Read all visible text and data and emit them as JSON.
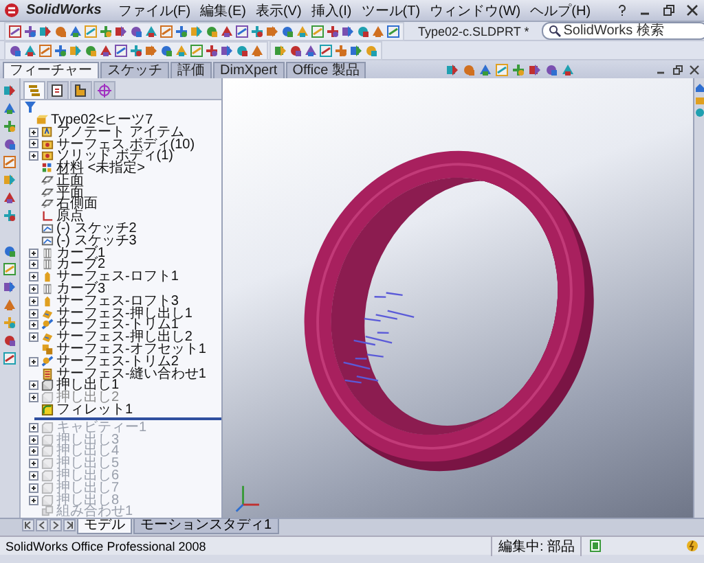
{
  "app": {
    "logo": "SolidWorks",
    "document_title": "Type02-c.SLDPRT *"
  },
  "menu": [
    "ファイル(F)",
    "編集(E)",
    "表示(V)",
    "挿入(I)",
    "ツール(T)",
    "ウィンドウ(W)",
    "ヘルプ(H)"
  ],
  "search": {
    "placeholder": "SolidWorks 検索"
  },
  "command_tabs": [
    {
      "label": "フィーチャー",
      "selected": true
    },
    {
      "label": "スケッチ",
      "selected": false
    },
    {
      "label": "評価",
      "selected": false
    },
    {
      "label": "DimXpert",
      "selected": false
    },
    {
      "label": "Office 製品",
      "selected": false
    }
  ],
  "feature_tree": {
    "tabs": [
      {
        "kind": "feature",
        "selected": true
      },
      {
        "kind": "property",
        "selected": false
      },
      {
        "kind": "configuration",
        "selected": false
      },
      {
        "kind": "dimxpert",
        "selected": false
      }
    ],
    "items": [
      {
        "label": "Type02<ヒーツ7",
        "kind": "part",
        "expandable": false,
        "suppressed": false,
        "rolled_back": false
      },
      {
        "label": "アノテート アイテム",
        "kind": "annotation",
        "expandable": true,
        "suppressed": false,
        "rolled_back": false
      },
      {
        "label": "サーフェス ボディ(10)",
        "kind": "folder",
        "expandable": true,
        "suppressed": false,
        "rolled_back": false
      },
      {
        "label": "ソリッド ボディ(1)",
        "kind": "folder",
        "expandable": true,
        "suppressed": false,
        "rolled_back": false
      },
      {
        "label": "材料 <未指定>",
        "kind": "material",
        "expandable": false,
        "suppressed": false,
        "rolled_back": false
      },
      {
        "label": "正面",
        "kind": "plane",
        "expandable": false,
        "suppressed": false,
        "rolled_back": false
      },
      {
        "label": "平面",
        "kind": "plane",
        "expandable": false,
        "suppressed": false,
        "rolled_back": false
      },
      {
        "label": "右側面",
        "kind": "plane",
        "expandable": false,
        "suppressed": false,
        "rolled_back": false
      },
      {
        "label": "原点",
        "kind": "origin",
        "expandable": false,
        "suppressed": false,
        "rolled_back": false
      },
      {
        "label": "(-) スケッチ2",
        "kind": "sketch",
        "expandable": false,
        "suppressed": false,
        "rolled_back": false
      },
      {
        "label": "(-) スケッチ3",
        "kind": "sketch",
        "expandable": false,
        "suppressed": false,
        "rolled_back": false
      },
      {
        "label": "カーブ1",
        "kind": "curve",
        "expandable": true,
        "suppressed": false,
        "rolled_back": false
      },
      {
        "label": "カーブ2",
        "kind": "curve",
        "expandable": true,
        "suppressed": false,
        "rolled_back": false
      },
      {
        "label": "サーフェス-ロフト1",
        "kind": "loft",
        "expandable": true,
        "suppressed": false,
        "rolled_back": false
      },
      {
        "label": "カーブ3",
        "kind": "curve",
        "expandable": true,
        "suppressed": false,
        "rolled_back": false
      },
      {
        "label": "サーフェス-ロフト3",
        "kind": "loft",
        "expandable": true,
        "suppressed": false,
        "rolled_back": false
      },
      {
        "label": "サーフェス-押し出し1",
        "kind": "surface",
        "expandable": true,
        "suppressed": false,
        "rolled_back": false
      },
      {
        "label": "サーフェス-トリム1",
        "kind": "trim",
        "expandable": true,
        "suppressed": false,
        "rolled_back": false
      },
      {
        "label": "サーフェス-押し出し2",
        "kind": "surface",
        "expandable": true,
        "suppressed": false,
        "rolled_back": false
      },
      {
        "label": "サーフェス-オフセット1",
        "kind": "offset",
        "expandable": false,
        "suppressed": false,
        "rolled_back": false
      },
      {
        "label": "サーフェス-トリム2",
        "kind": "trim",
        "expandable": true,
        "suppressed": false,
        "rolled_back": false
      },
      {
        "label": "サーフェス-縫い合わせ1",
        "kind": "knit",
        "expandable": false,
        "suppressed": false,
        "rolled_back": false
      },
      {
        "label": "押し出し1",
        "kind": "extrude",
        "expandable": true,
        "suppressed": false,
        "rolled_back": false
      },
      {
        "label": "押し出し2",
        "kind": "extrude",
        "expandable": true,
        "suppressed": true,
        "rolled_back": false
      },
      {
        "label": "フィレット1",
        "kind": "fillet",
        "expandable": false,
        "suppressed": false,
        "rolled_back": false
      },
      {
        "label": "キャビティー1",
        "kind": "extrude",
        "expandable": true,
        "suppressed": false,
        "rolled_back": true
      },
      {
        "label": "押し出し3",
        "kind": "extrude",
        "expandable": true,
        "suppressed": false,
        "rolled_back": true
      },
      {
        "label": "押し出し4",
        "kind": "extrude",
        "expandable": true,
        "suppressed": false,
        "rolled_back": true
      },
      {
        "label": "押し出し5",
        "kind": "extrude",
        "expandable": true,
        "suppressed": false,
        "rolled_back": true
      },
      {
        "label": "押し出し6",
        "kind": "extrude",
        "expandable": true,
        "suppressed": false,
        "rolled_back": true
      },
      {
        "label": "押し出し7",
        "kind": "extrude",
        "expandable": true,
        "suppressed": false,
        "rolled_back": true
      },
      {
        "label": "押し出し8",
        "kind": "extrude",
        "expandable": true,
        "suppressed": false,
        "rolled_back": true
      },
      {
        "label": "組み合わせ1",
        "kind": "combine",
        "expandable": false,
        "suppressed": false,
        "rolled_back": true
      }
    ]
  },
  "bottom_tabs": [
    {
      "label": "モデル",
      "selected": true
    },
    {
      "label": "モーションスタディ1",
      "selected": false
    }
  ],
  "status_bar": {
    "product": "SolidWorks Office Professional 2008",
    "mode": "編集中: 部品"
  }
}
